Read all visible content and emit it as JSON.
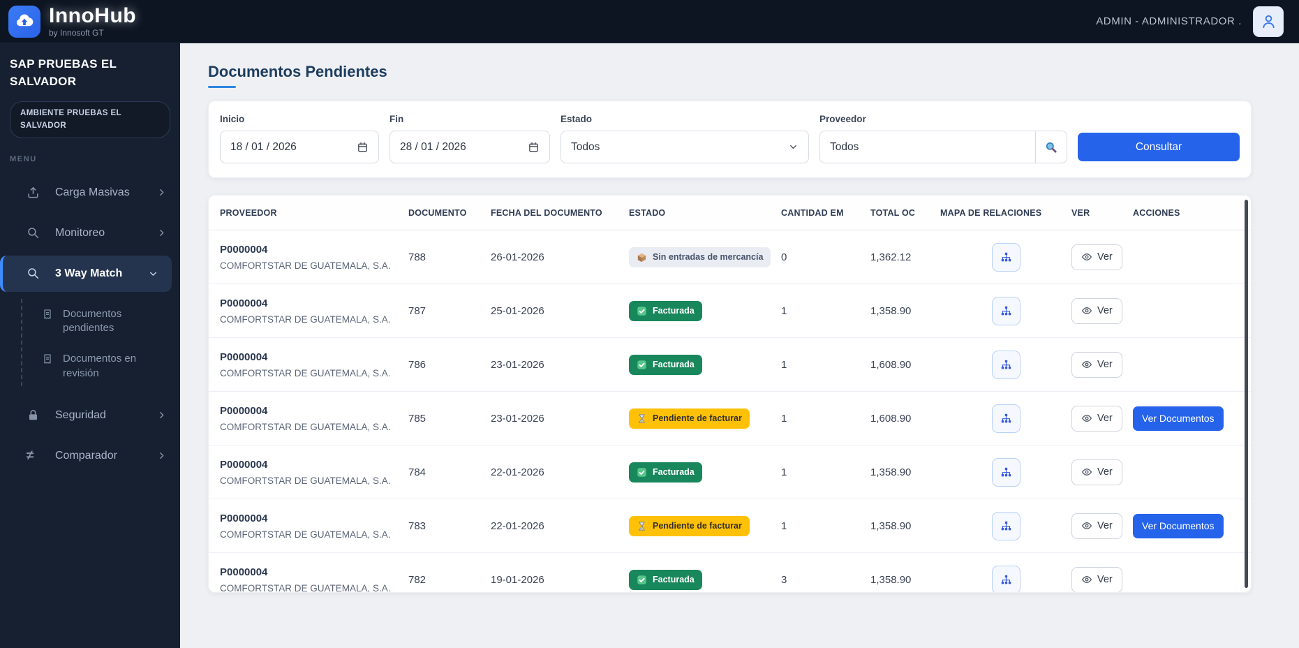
{
  "navbar": {
    "brand": "InnoHub",
    "brand_sub": "by Innosoft GT",
    "user_label": "ADMIN - ADMINISTRADOR ."
  },
  "sidebar": {
    "org_title": "SAP PRUEBAS EL SALVADOR",
    "environment_badge": "AMBIENTE PRUEBAS EL SALVADOR",
    "menu_label": "MENU",
    "items": [
      {
        "label": "Carga Masivas",
        "icon": "upload-icon"
      },
      {
        "label": "Monitoreo",
        "icon": "search-icon"
      },
      {
        "label": "3 Way Match",
        "icon": "search-icon",
        "active": true,
        "expanded": true
      },
      {
        "label": "Seguridad",
        "icon": "lock-icon"
      },
      {
        "label": "Comparador",
        "icon": "not-equal-icon",
        "icon_glyph": "≠"
      }
    ],
    "subitems": [
      {
        "label": "Documentos pendientes",
        "icon": "receipt-icon"
      },
      {
        "label": "Documentos en revisión",
        "icon": "receipt-icon"
      }
    ]
  },
  "main": {
    "title": "Documentos Pendientes",
    "filters": {
      "inicio_label": "Inicio",
      "inicio_value": "18 / 01 / 2026",
      "fin_label": "Fin",
      "fin_value": "28 / 01 / 2026",
      "estado_label": "Estado",
      "estado_value": "Todos",
      "proveedor_label": "Proveedor",
      "proveedor_value": "Todos",
      "consultar_label": "Consultar"
    },
    "table": {
      "headers": [
        "PROVEEDOR",
        "DOCUMENTO",
        "FECHA DEL DOCUMENTO",
        "ESTADO",
        "CANTIDAD EM",
        "TOTAL OC",
        "MAPA DE RELACIONES",
        "VER",
        "ACCIONES"
      ],
      "ver_label": "Ver",
      "action_label": "Ver Documentos",
      "rows": [
        {
          "proveedor_codigo": "P0000004",
          "proveedor_nombre": "COMFORTSTAR DE GUATEMALA, S.A.",
          "documento": "788",
          "fecha": "26-01-2026",
          "estado": "Sin entradas de mercancía",
          "estado_tipo": "neutral",
          "cantidad_em": "0",
          "total_oc": "1,362.12",
          "accion": false
        },
        {
          "proveedor_codigo": "P0000004",
          "proveedor_nombre": "COMFORTSTAR DE GUATEMALA, S.A.",
          "documento": "787",
          "fecha": "25-01-2026",
          "estado": "Facturada",
          "estado_tipo": "success",
          "cantidad_em": "1",
          "total_oc": "1,358.90",
          "accion": false
        },
        {
          "proveedor_codigo": "P0000004",
          "proveedor_nombre": "COMFORTSTAR DE GUATEMALA, S.A.",
          "documento": "786",
          "fecha": "23-01-2026",
          "estado": "Facturada",
          "estado_tipo": "success",
          "cantidad_em": "1",
          "total_oc": "1,608.90",
          "accion": false
        },
        {
          "proveedor_codigo": "P0000004",
          "proveedor_nombre": "COMFORTSTAR DE GUATEMALA, S.A.",
          "documento": "785",
          "fecha": "23-01-2026",
          "estado": "Pendiente de facturar",
          "estado_tipo": "warning",
          "cantidad_em": "1",
          "total_oc": "1,608.90",
          "accion": true
        },
        {
          "proveedor_codigo": "P0000004",
          "proveedor_nombre": "COMFORTSTAR DE GUATEMALA, S.A.",
          "documento": "784",
          "fecha": "22-01-2026",
          "estado": "Facturada",
          "estado_tipo": "success",
          "cantidad_em": "1",
          "total_oc": "1,358.90",
          "accion": false
        },
        {
          "proveedor_codigo": "P0000004",
          "proveedor_nombre": "COMFORTSTAR DE GUATEMALA, S.A.",
          "documento": "783",
          "fecha": "22-01-2026",
          "estado": "Pendiente de facturar",
          "estado_tipo": "warning",
          "cantidad_em": "1",
          "total_oc": "1,358.90",
          "accion": true
        },
        {
          "proveedor_codigo": "P0000004",
          "proveedor_nombre": "COMFORTSTAR DE GUATEMALA, S.A.",
          "documento": "782",
          "fecha": "19-01-2026",
          "estado": "Facturada",
          "estado_tipo": "success",
          "cantidad_em": "3",
          "total_oc": "1,358.90",
          "accion": false
        }
      ]
    }
  },
  "icons": {
    "brand": "cloud-upload-icon",
    "user": "person-icon",
    "date": "calendar-icon",
    "estado_dropdown": "chevron-down-icon",
    "proveedor_search": "magnifier-icon",
    "estado_neutral": "package-icon",
    "estado_success": "check-icon",
    "estado_warning": "hourglass-icon",
    "mapa": "sitemap-icon",
    "ver": "eye-icon"
  },
  "colors": {
    "accent": "#2563eb",
    "navbar_bg": "#0d1522",
    "sidebar_bg": "#162031",
    "active_item_bg": "#24344f",
    "active_item_border": "#3f8cfd",
    "badge_success": "#19875c",
    "badge_warning": "#ffc107",
    "badge_neutral": "#e9ecf2",
    "title": "#1d3c5e"
  }
}
